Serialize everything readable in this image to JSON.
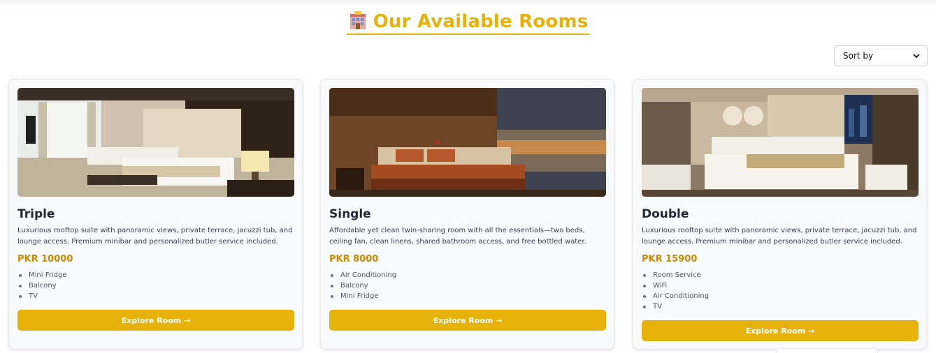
{
  "page": {
    "heading": "Our Available Rooms",
    "heading_icon": "hotel-icon",
    "accent_color": "#e6b10a",
    "price_color": "#c98a06"
  },
  "sort": {
    "label": "Sort by",
    "icon": "chevron-down-icon"
  },
  "rooms": [
    {
      "title": "Triple",
      "description": "Luxurious rooftop suite with panoramic views, private terrace, jacuzzi tub, and lounge access. Premium minibar and personalized butler service included. Luxurious roofto...",
      "price": "PKR 10000",
      "features": [
        "Mini Fridge",
        "Balcony",
        "TV"
      ],
      "button": "Explore Room →"
    },
    {
      "title": "Single",
      "description": "Affordable yet clean twin-sharing room with all the essentials—two beds, ceiling fan, clean linens, shared bathroom access, and free bottled water.",
      "price": "PKR 8000",
      "features": [
        "Air Conditioning",
        "Balcony",
        "Mini Fridge"
      ],
      "button": "Explore Room →"
    },
    {
      "title": "Double",
      "description": "Luxurious rooftop suite with panoramic views, private terrace, jacuzzi tub, and lounge access. Premium minibar and personalized butler service included.",
      "price": "PKR 15900",
      "features": [
        "Room Service",
        "WiFi",
        "Air Conditioning",
        "TV"
      ],
      "button": "Explore Room →"
    }
  ]
}
